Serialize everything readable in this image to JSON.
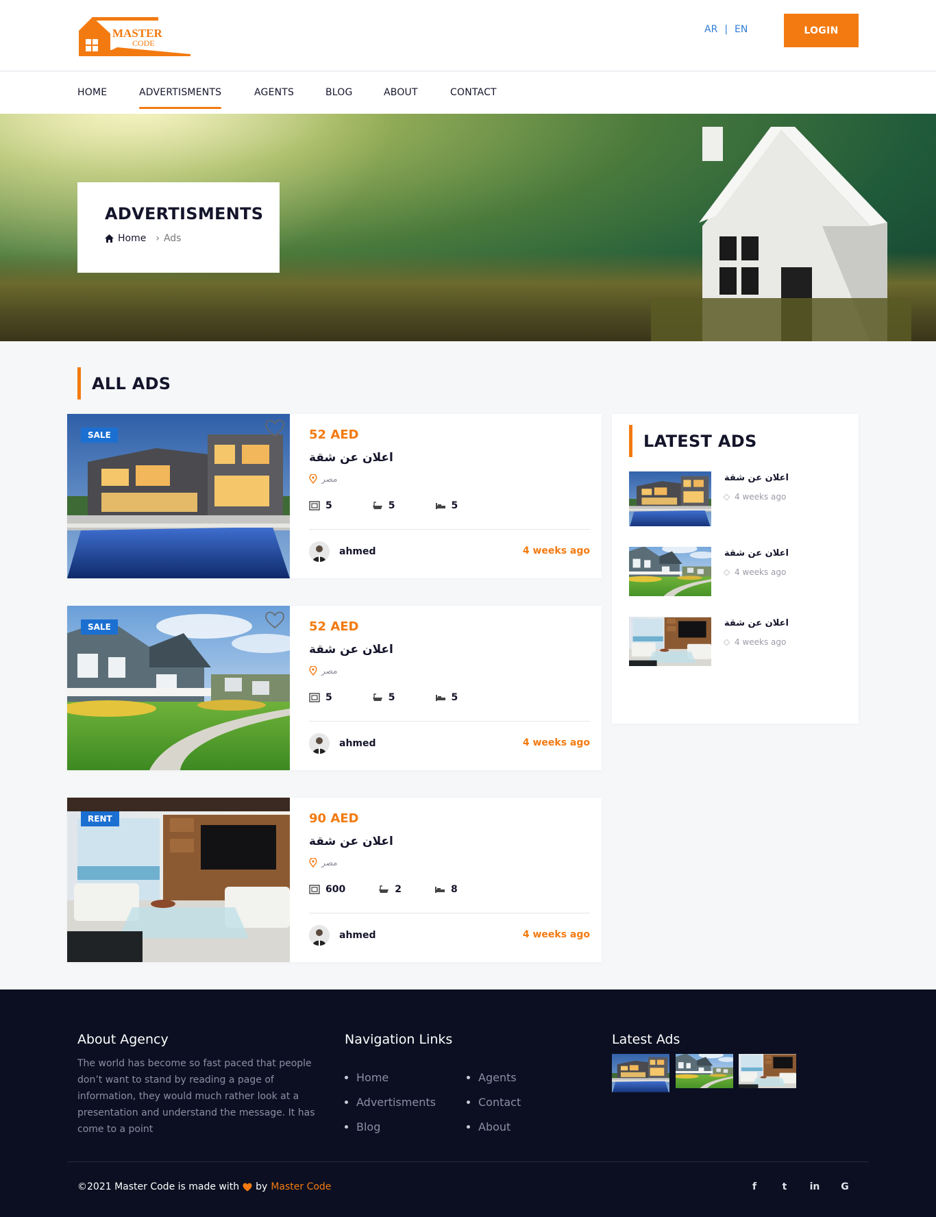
{
  "header": {
    "logo_line1": "MASTER",
    "logo_line2": "CODE",
    "lang_ar": "AR",
    "lang_sep": "|",
    "lang_en": "EN",
    "login_label": "LOGIN"
  },
  "nav": {
    "items": [
      {
        "label": "HOME"
      },
      {
        "label": "ADVERTISMENTS"
      },
      {
        "label": "AGENTS"
      },
      {
        "label": "BLOG"
      },
      {
        "label": "ABOUT"
      },
      {
        "label": "CONTACT"
      }
    ],
    "active": "ADVERTISMENTS"
  },
  "hero": {
    "title": "ADVERTISMENTS",
    "crumb_home": "Home",
    "crumb_current": "Ads"
  },
  "all_ads": {
    "heading": "ALL ADS",
    "items": [
      {
        "badge": "SALE",
        "price": "52 AED",
        "title": "اعلان عن شقة",
        "location": "مصر",
        "area": "5",
        "baths": "5",
        "beds": "5",
        "agent": "ahmed",
        "time": "4 weeks ago"
      },
      {
        "badge": "SALE",
        "price": "52 AED",
        "title": "اعلان عن شقة",
        "location": "مصر",
        "area": "5",
        "baths": "5",
        "beds": "5",
        "agent": "ahmed",
        "time": "4 weeks ago"
      },
      {
        "badge": "RENT",
        "price": "90 AED",
        "title": "اعلان عن شقة",
        "location": "مصر",
        "area": "600",
        "baths": "2",
        "beds": "8",
        "agent": "ahmed",
        "time": "4 weeks ago"
      }
    ]
  },
  "latest_ads": {
    "heading": "LATEST ADS",
    "items": [
      {
        "title": "اعلان عن شقة",
        "time": "4 weeks ago"
      },
      {
        "title": "اعلان عن شقة",
        "time": "4 weeks ago"
      },
      {
        "title": "اعلان عن شقة",
        "time": "4 weeks ago"
      }
    ]
  },
  "footer": {
    "about_title": "About Agency",
    "about_text": "The world has become so fast paced that people don’t want to stand by reading a page of information, they would much rather look at a presentation and understand the message. It has come to a point",
    "nav_title": "Navigation Links",
    "nav_col1": [
      "Home",
      "Advertisments",
      "Blog"
    ],
    "nav_col2": [
      "Agents",
      "Contact",
      "About"
    ],
    "latest_title": "Latest Ads",
    "copyright_prefix": "©2021 Master Code is made with",
    "copyright_by": "by",
    "copyright_brand": "Master Code",
    "social": {
      "facebook": "f",
      "twitter": "t",
      "linkedin": "in",
      "google": "G"
    }
  },
  "colors": {
    "accent": "#f37a10",
    "badge_blue": "#1b6fd1",
    "footer_bg": "#0b0f21",
    "dark_text": "#14142b"
  }
}
